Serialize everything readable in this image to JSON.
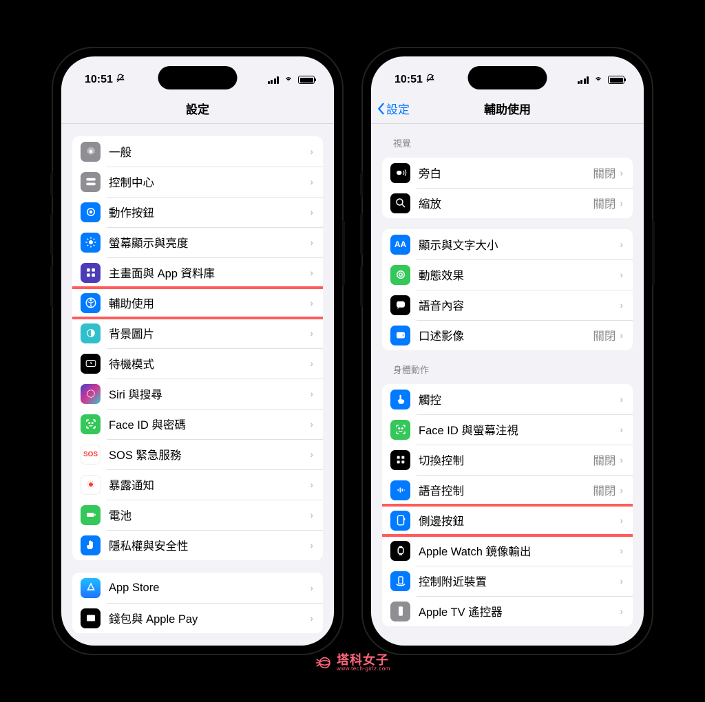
{
  "status": {
    "time": "10:51"
  },
  "left": {
    "title": "設定",
    "group1": [
      {
        "id": "general",
        "label": "一般",
        "icon_bg": "#8e8e93"
      },
      {
        "id": "control-center",
        "label": "控制中心",
        "icon_bg": "#8e8e93"
      },
      {
        "id": "action-button",
        "label": "動作按鈕",
        "icon_bg": "#007aff"
      },
      {
        "id": "display",
        "label": "螢幕顯示與亮度",
        "icon_bg": "#007aff"
      },
      {
        "id": "home-screen",
        "label": "主畫面與 App 資料庫",
        "icon_bg": "#3c3cc2"
      },
      {
        "id": "accessibility",
        "label": "輔助使用",
        "icon_bg": "#007aff",
        "highlight": true
      },
      {
        "id": "wallpaper",
        "label": "背景圖片",
        "icon_bg": "#36c5ce"
      },
      {
        "id": "standby",
        "label": "待機模式",
        "icon_bg": "#000000"
      },
      {
        "id": "siri",
        "label": "Siri 與搜尋",
        "icon_bg": "#1a1a1a"
      },
      {
        "id": "faceid",
        "label": "Face ID 與密碼",
        "icon_bg": "#34c759"
      },
      {
        "id": "sos",
        "label": "SOS 緊急服務",
        "icon_bg": "#ffffff",
        "text_color": "#ff3b30",
        "icon_text": "SOS"
      },
      {
        "id": "exposure",
        "label": "暴露通知",
        "icon_bg": "#ffffff"
      },
      {
        "id": "battery",
        "label": "電池",
        "icon_bg": "#34c759"
      },
      {
        "id": "privacy",
        "label": "隱私權與安全性",
        "icon_bg": "#007aff"
      }
    ],
    "group2": [
      {
        "id": "appstore",
        "label": "App Store",
        "icon_bg": "#1e90ff"
      },
      {
        "id": "wallet",
        "label": "錢包與 Apple Pay",
        "icon_bg": "#000000"
      }
    ]
  },
  "right": {
    "back": "設定",
    "title": "輔助使用",
    "section1_header": "視覺",
    "group1": [
      {
        "id": "voiceover",
        "label": "旁白",
        "value": "關閉",
        "icon_bg": "#000000"
      },
      {
        "id": "zoom",
        "label": "縮放",
        "value": "關閉",
        "icon_bg": "#000000"
      }
    ],
    "group2": [
      {
        "id": "display-text",
        "label": "顯示與文字大小",
        "icon_bg": "#007aff",
        "icon_text": "AA"
      },
      {
        "id": "motion",
        "label": "動態效果",
        "icon_bg": "#34c759"
      },
      {
        "id": "spoken-content",
        "label": "語音內容",
        "icon_bg": "#000000"
      },
      {
        "id": "audio-desc",
        "label": "口述影像",
        "value": "關閉",
        "icon_bg": "#007aff"
      }
    ],
    "section2_header": "身體動作",
    "group3": [
      {
        "id": "touch",
        "label": "觸控",
        "icon_bg": "#007aff"
      },
      {
        "id": "faceid-attention",
        "label": "Face ID 與螢幕注視",
        "icon_bg": "#34c759"
      },
      {
        "id": "switch-control",
        "label": "切換控制",
        "value": "關閉",
        "icon_bg": "#000000"
      },
      {
        "id": "voice-control",
        "label": "語音控制",
        "value": "關閉",
        "icon_bg": "#007aff"
      },
      {
        "id": "side-button",
        "label": "側邊按鈕",
        "icon_bg": "#007aff",
        "highlight": true
      },
      {
        "id": "apple-watch",
        "label": "Apple Watch 鏡像輸出",
        "icon_bg": "#000000"
      },
      {
        "id": "nearby",
        "label": "控制附近裝置",
        "icon_bg": "#007aff"
      },
      {
        "id": "apple-tv",
        "label": "Apple TV 遙控器",
        "icon_bg": "#8e8e93"
      }
    ]
  },
  "watermark": {
    "main": "塔科女子",
    "sub": "www.tech-girlz.com"
  }
}
